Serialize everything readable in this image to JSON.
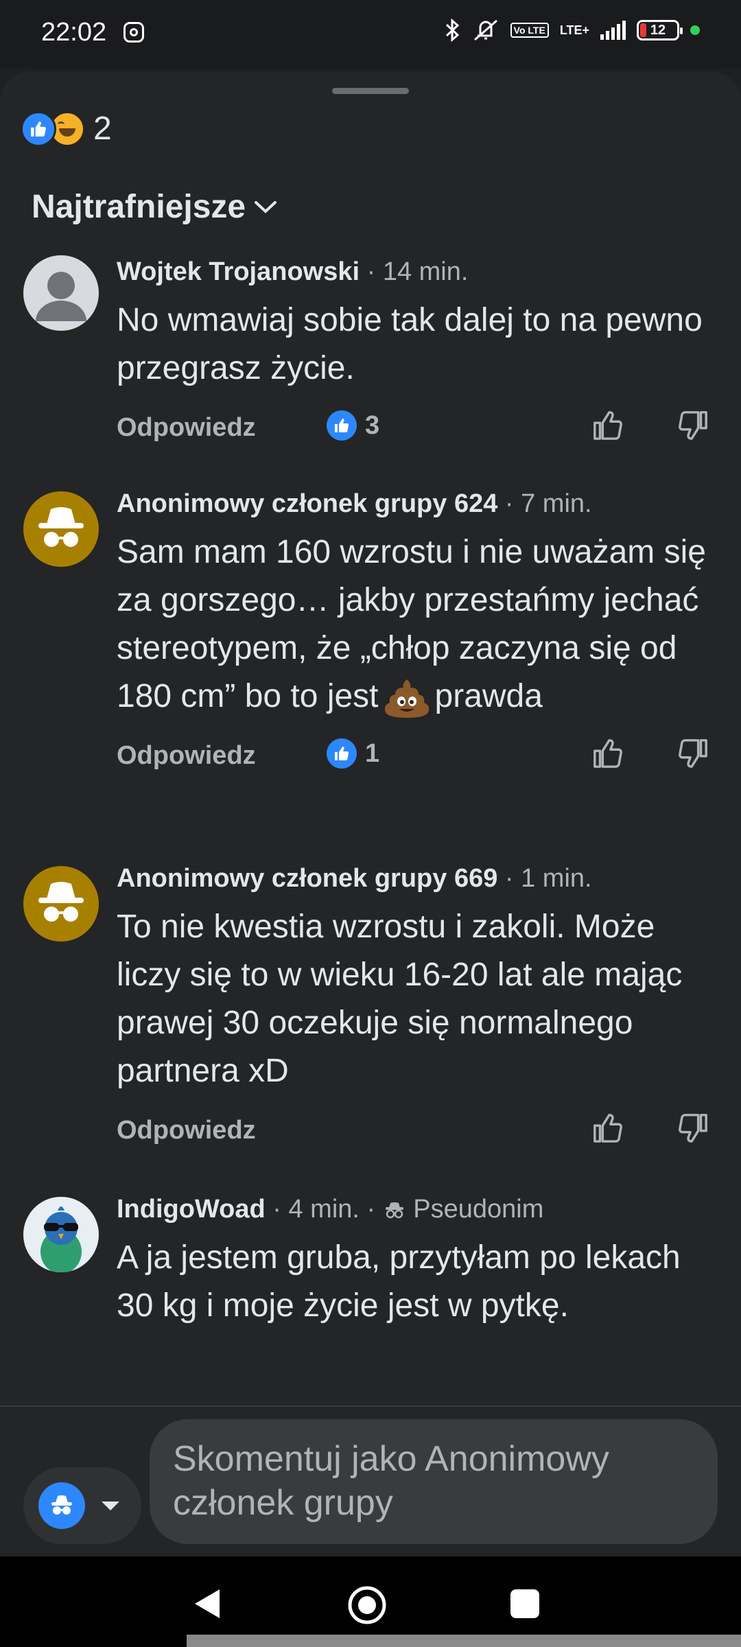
{
  "status_bar": {
    "time": "22:02",
    "icons": [
      "instagram-icon",
      "bluetooth-icon",
      "vibrate-off-icon",
      "volte-icon",
      "lte-signal-icon",
      "battery-icon",
      "privacy-dot-icon"
    ],
    "volte": "Vo LTE",
    "network": "LTE+",
    "battery": "12"
  },
  "post_reactions": {
    "count": "2",
    "types": [
      "like",
      "haha"
    ]
  },
  "sort": {
    "label": "Najtrafniejsze"
  },
  "comments": [
    {
      "author": "Wojtek Trojanowski",
      "time": "· 14 min.",
      "text": "No wmawiaj sobie tak dalej to na pewno przegrasz życie.",
      "reply": "Odpowiedz",
      "likes": "3"
    },
    {
      "author": "Anonimowy członek grupy 624",
      "time": "· 7 min.",
      "text_before_emoji": "Sam mam 160 wzrostu i nie uważam się za gorszego… jakby przestańmy jechać stereotypem, że „chłop zaczyna się od 180 cm” bo to jest",
      "text_after_emoji": "prawda",
      "emoji": "poop-emoji",
      "reply": "Odpowiedz",
      "likes": "1"
    },
    {
      "author": "Anonimowy członek grupy 669",
      "time": "· 1 min.",
      "text": "To nie kwestia wzrostu i zakoli. Może liczy się to w wieku 16-20 lat ale mając prawej 30 oczekuje się normalnego partnera xD",
      "reply": "Odpowiedz"
    },
    {
      "author": "IndigoWoad",
      "time": "· 4 min. ·",
      "badge": "Pseudonim",
      "text": "A ja jestem gruba, przytyłam po lekach 30 kg i moje życie jest w pytkę."
    }
  ],
  "composer": {
    "placeholder": "Skomentuj jako Anonimowy członek grupy"
  },
  "colors": {
    "sheet_bg": "#242526",
    "accent": "#2d88ff",
    "anon_avatar": "#a88000",
    "text_secondary": "#b0b3b8"
  }
}
